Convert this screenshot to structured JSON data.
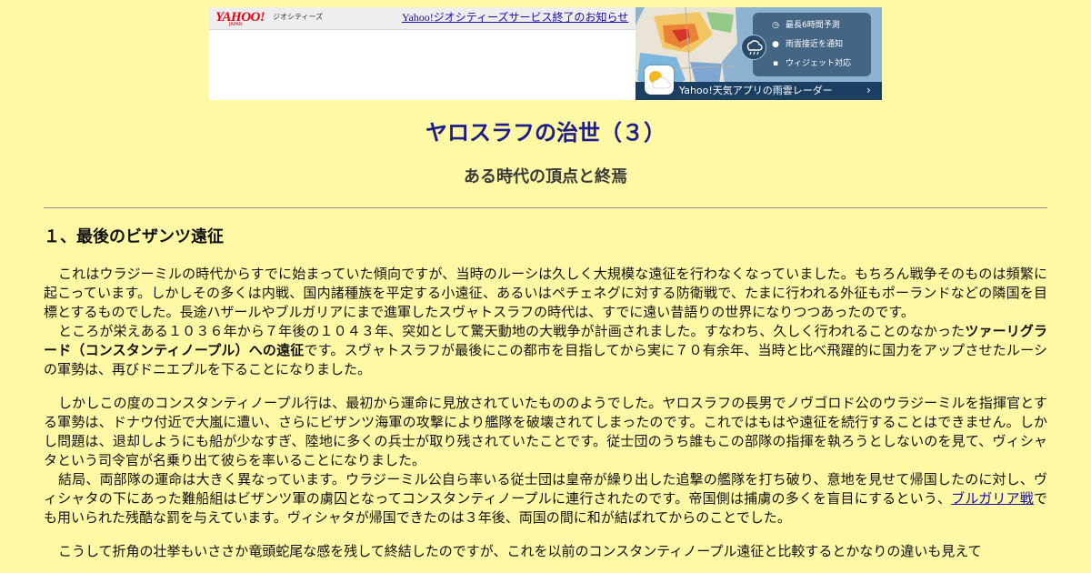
{
  "ad": {
    "brand": "YAHOO!",
    "brand_sub": "JAPAN",
    "brand_service": "ジオシティーズ",
    "notice_link": "Yahoo!ジオシティーズサービス終了のお知らせ",
    "weather": {
      "features": [
        {
          "icon": "clock-icon",
          "label": "最長6時間予測"
        },
        {
          "icon": "location-pin-icon",
          "label": "雨雲接近を通知"
        },
        {
          "icon": "widget-grid-icon",
          "label": "ウィジェット対応"
        }
      ],
      "cta": "Yahoo!天気アプリの雨雲レーダー",
      "accent": "#1b3f63"
    }
  },
  "article": {
    "title": "ヤロスラフの治世（３）",
    "subtitle": "ある時代の頂点と終焉",
    "section_heading": "１、最後のビザンツ遠征",
    "p1": "これはウラジーミルの時代からすでに始まっていた傾向ですが、当時のルーシは久しく大規模な遠征を行わなくなっていました。もちろん戦争そのものは頻繁に起こっています。しかしその多くは内戦、国内諸種族を平定する小遠征、あるいはペチェネグに対する防衛戦で、たまに行われる外征もポーランドなどの隣国を目標とするものでした。長途ハザールやブルガリアにまで進軍したスヴャトスラフの時代は、すでに遠い昔語りの世界になりつつあったのです。",
    "p2_pre": "ところが栄えある１０３６年から７年後の１０４３年、突如として驚天動地の大戦争が計画されました。すなわち、久しく行われることのなかった",
    "p2_bold": "ツァーリグラード（コンスタンティノープル）への遠征",
    "p2_post": "です。スヴャトスラフが最後にこの都市を目指してから実に７０有余年、当時と比べ飛躍的に国力をアップさせたルーシの軍勢は、再びドニエプルを下ることになりました。",
    "p3": "しかしこの度のコンスタンティノープル行は、最初から運命に見放されていたもののようでした。ヤロスラフの長男でノヴゴロド公のウラジーミルを指揮官とする軍勢は、ドナウ付近で大嵐に遭い、さらにビザンツ海軍の攻撃により艦隊を破壊されてしまったのです。これではもはや遠征を続行することはできません。しかし問題は、退却しようにも船が少なすぎ、陸地に多くの兵士が取り残されていたことです。従士団のうち誰もこの部隊の指揮を執ろうとしないのを見て、ヴィシャタという司令官が名乗り出て彼らを率いることになりました。",
    "p4_pre": "結局、両部隊の運命は大きく異なっています。ウラジーミル公自ら率いる従士団は皇帝が繰り出した追撃の艦隊を打ち破り、意地を見せて帰国したのに対し、ヴィシャタの下にあった難船組はビザンツ軍の虜囚となってコンスタンティノープルに連行されたのです。帝国側は捕虜の多くを盲目にするという、",
    "p4_link": "ブルガリア戦",
    "p4_post": "でも用いられた残酷な罰を与えています。ヴィシャタが帰国できたのは３年後、両国の間に和が結ばれてからのことでした。",
    "p5": "こうして折角の壮挙もいささか竜頭蛇尾な感を残して終結したのですが、これを以前のコンスタンティノープル遠征と比較するとかなりの違いも見えて"
  },
  "colors": {
    "background": "#fff8a4",
    "title": "#1c1c8a",
    "link": "#1a0dab"
  }
}
